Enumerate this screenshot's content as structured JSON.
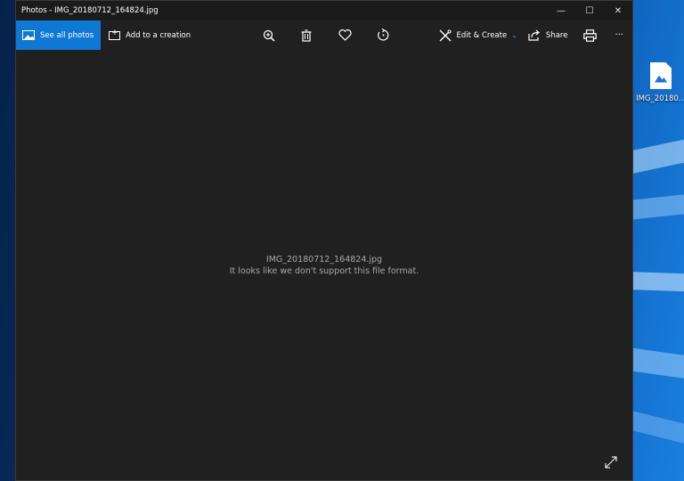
{
  "window": {
    "title": "Photos - IMG_20180712_164824.jpg",
    "controls": {
      "minimize": "—",
      "maximize": "☐",
      "close": "✕"
    }
  },
  "toolbar": {
    "see_all_photos": "See all photos",
    "add_to_creation": "Add to a creation",
    "edit_create": "Edit & Create",
    "share": "Share",
    "more": "···",
    "icons": [
      "zoom-icon",
      "delete-icon",
      "favorite-icon",
      "rotate-icon",
      "edit-create-icon",
      "share-icon",
      "print-icon"
    ]
  },
  "content": {
    "filename": "IMG_20180712_164824.jpg",
    "message": "It looks like we don't support this file format."
  },
  "desktop": {
    "icon_label": "IMG_20180..."
  },
  "colors": {
    "accent": "#0f78d4",
    "window_bg": "#202020",
    "titlebar_bg": "#1b1b1b",
    "message_text": "#a8a8a8"
  }
}
